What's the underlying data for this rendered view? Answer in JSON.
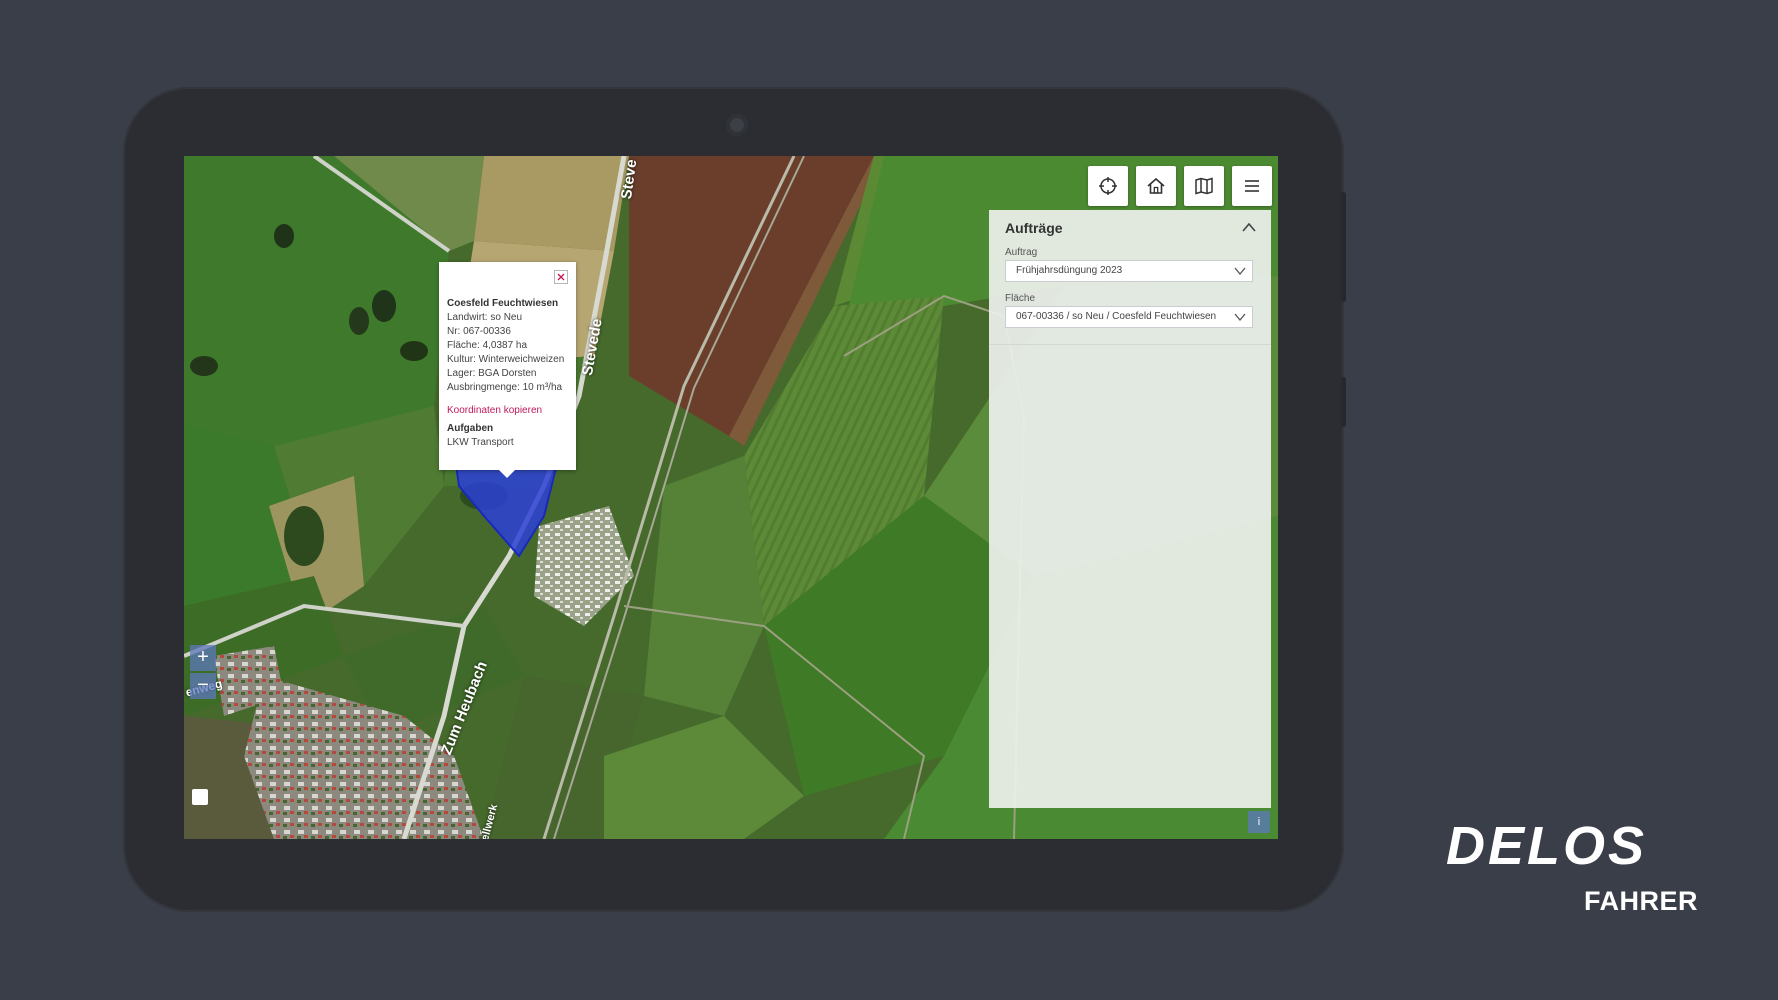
{
  "map": {
    "streets": [
      "Stevede",
      "Steve",
      "Zum Heubach",
      "enweg",
      "ellwerk"
    ]
  },
  "toolbar": {
    "icons": [
      "crosshair-icon",
      "home-icon",
      "map-icon",
      "menu-icon"
    ]
  },
  "popup": {
    "title": "Coesfeld Feuchtwiesen",
    "lines": [
      "Landwirt: so Neu",
      "Nr: 067-00336",
      "Fläche: 4,0387 ha",
      "Kultur: Winterweichweizen",
      "Lager: BGA Dorsten",
      "Ausbringmenge: 10 m³/ha"
    ],
    "link": "Koordinaten kopieren",
    "tasks_title": "Aufgaben",
    "task": "LKW Transport"
  },
  "panel": {
    "title": "Aufträge",
    "order_label": "Auftrag",
    "order_value": "Frühjahrsdüngung 2023",
    "area_label": "Fläche",
    "area_value": "067-00336 / so Neu / Coesfeld Feuchtwiesen"
  },
  "zoom": {
    "in": "+",
    "out": "−"
  },
  "info": "i",
  "brand": {
    "logo": "DELOS",
    "subtitle": "FAHRER"
  },
  "colors": {
    "background": "#3a3e48",
    "tablet": "#2b2d32",
    "link": "#c2185b",
    "field_highlight": "#2c3fd6"
  }
}
